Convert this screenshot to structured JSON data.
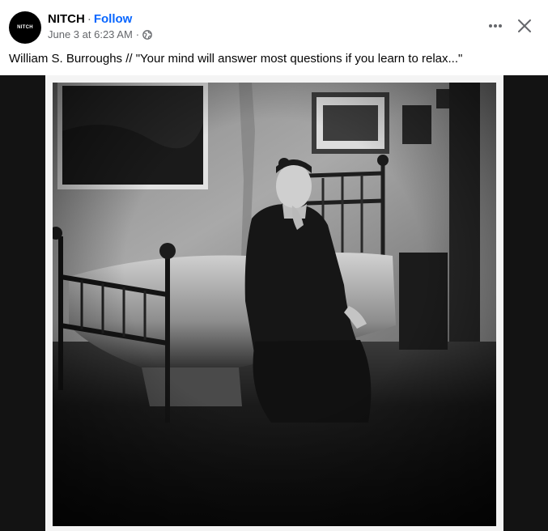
{
  "post": {
    "avatar_text": "NITCH",
    "page_name": "NITCH",
    "separator": "·",
    "follow_label": "Follow",
    "timestamp": "June 3 at 6:23 AM",
    "meta_separator": "·",
    "audience_icon": "globe-icon",
    "caption": "William S. Burroughs // \"Your mind will answer most questions if you learn to relax...\""
  },
  "controls": {
    "more_icon": "more-horizontal-icon",
    "close_icon": "close-icon"
  },
  "colors": {
    "link": "#0866ff",
    "secondary_text": "#65676b",
    "primary_text": "#050505",
    "media_background": "#131313"
  }
}
